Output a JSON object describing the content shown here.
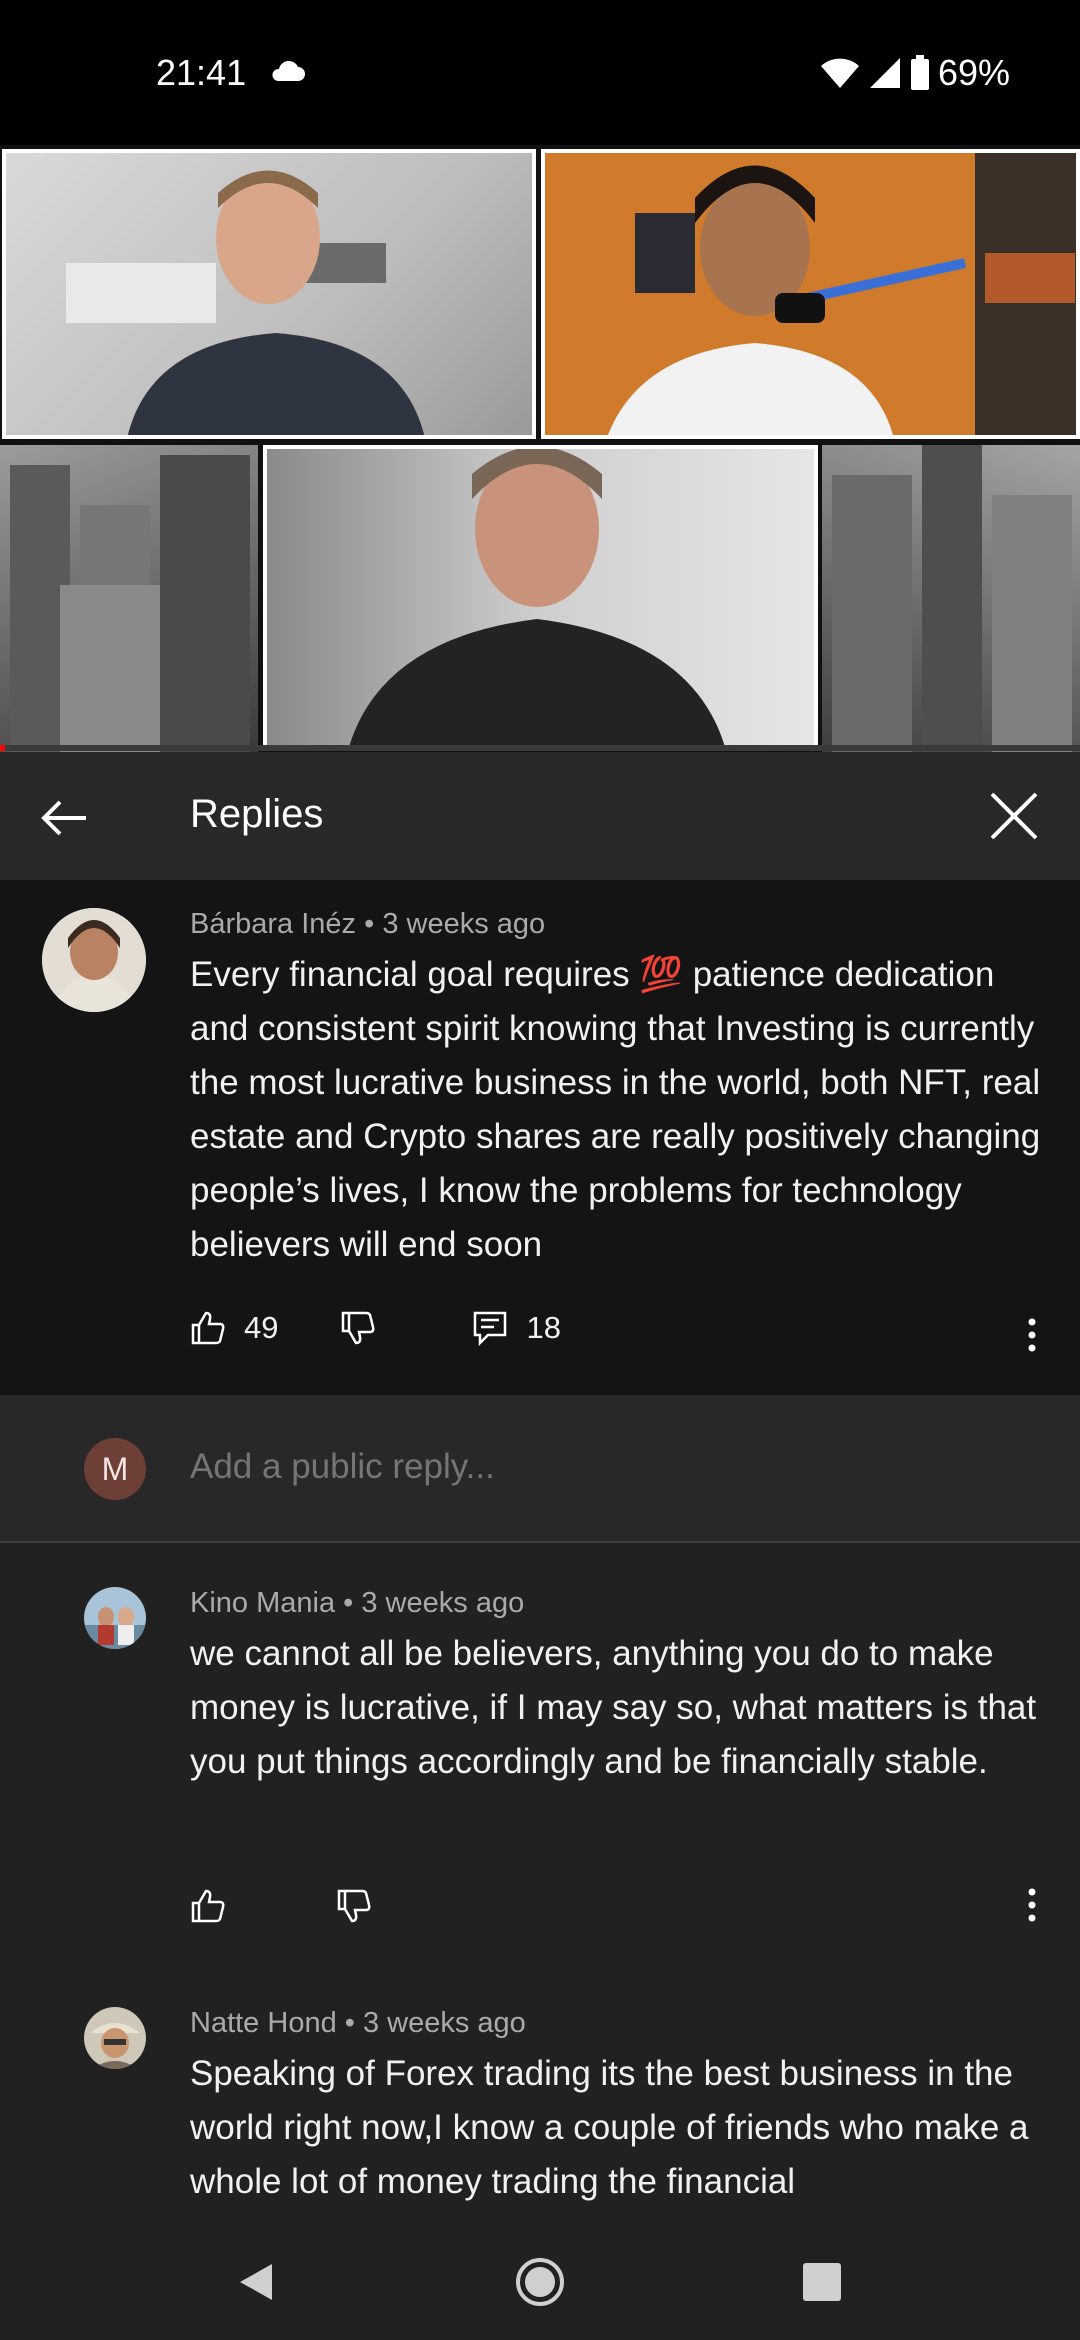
{
  "status_bar": {
    "time": "21:41",
    "battery": "69%"
  },
  "video": {
    "progress": 0.005
  },
  "header": {
    "title": "Replies"
  },
  "parent_comment": {
    "author": "Bárbara Inéz",
    "age": "3 weeks ago",
    "text": "Every financial goal requires 💯 patience dedication and consistent spirit knowing that Investing is currently the most lucrative business in the world, both NFT, real estate and Crypto shares are really positively changing people’s lives, I know the problems for technology believers will end soon",
    "likes": "49",
    "replies": "18"
  },
  "add_reply": {
    "avatar_letter": "M",
    "placeholder": "Add a public reply..."
  },
  "replies": [
    {
      "author": "Kino Mania",
      "age": "3 weeks ago",
      "text": "we cannot all be believers, anything you do to make money is lucrative, if I may say so, what matters is that you put things accordingly and be financially stable."
    },
    {
      "author": "Natte Hond",
      "age": "3 weeks ago",
      "text": "Speaking of Forex trading its the best business in the world right now,I know a couple of friends who make a whole lot of money trading the financial"
    }
  ]
}
